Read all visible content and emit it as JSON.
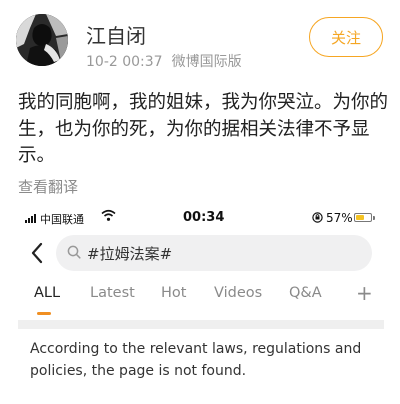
{
  "post": {
    "username": "江自闭",
    "timestamp": "10-2 00:37",
    "source": "微博国际版",
    "follow_label": "关注",
    "text": "我的同胞啊，我的姐妹，我为你哭泣。为你的生，也为你的死，为你的据相关法律不予显示。",
    "translate_label": "查看翻译"
  },
  "screenshot": {
    "status": {
      "carrier": "中国联通",
      "time": "00:34",
      "battery": "57%",
      "battery_level": 0.57
    },
    "search": {
      "query": "#拉姆法案#"
    },
    "tabs": [
      "ALL",
      "Latest",
      "Hot",
      "Videos",
      "Q&A"
    ],
    "active_tab": "ALL",
    "notice": "According to the relevant laws, regulations and policies, the page is not found."
  },
  "colors": {
    "accent": "#f5a623",
    "tab_indicator": "#f08f22",
    "battery": "#f4c324"
  },
  "icons": {
    "avatar": "avatar",
    "back": "chevron-left-icon",
    "search": "search-icon",
    "add_tab": "plus-icon",
    "wifi": "wifi-icon",
    "lock": "rotation-lock-icon"
  }
}
